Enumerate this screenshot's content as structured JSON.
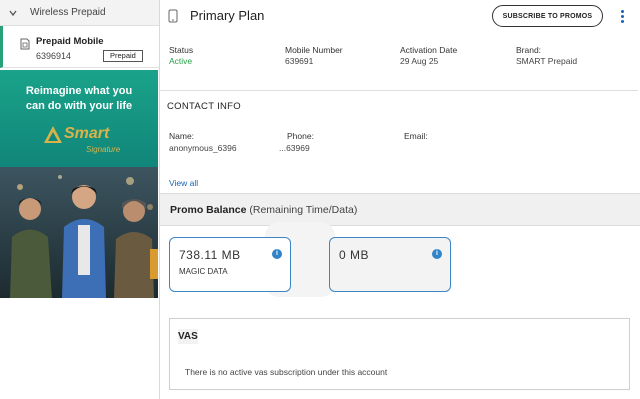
{
  "sidebar": {
    "header_title": "Wireless Prepaid",
    "account": {
      "name": "Prepaid Mobile",
      "number": "6396914",
      "tag": "Prepaid"
    },
    "banner": {
      "headline_line1": "Reimagine what you",
      "headline_line2": "can do with your life",
      "brand": "Smart",
      "brand_sub": "Signature"
    }
  },
  "main": {
    "plan_title": "Primary Plan",
    "subscribe_button": "SUBSCRIBE TO PROMOS",
    "status": {
      "label": "Status",
      "value": "Active"
    },
    "mobile_number": {
      "label": "Mobile Number",
      "value": "639691"
    },
    "activation_date": {
      "label": "Activation Date",
      "value": "29 Aug 25"
    },
    "brand": {
      "label": "Brand:",
      "value": "SMART Prepaid"
    },
    "contact_info": {
      "title": "CONTACT INFO",
      "name_label": "Name:",
      "name_value": "anonymous_6396",
      "phone_label": "Phone:",
      "phone_value": "...63969",
      "email_label": "Email:",
      "view_all": "View all"
    },
    "promo_balance": {
      "title": "Promo Balance",
      "subtitle": "(Remaining Time/Data)",
      "cards": [
        {
          "amount": "738.11 MB",
          "label": "MAGIC DATA"
        },
        {
          "amount": "0 MB",
          "label": ""
        }
      ]
    },
    "vas": {
      "title": "VAS",
      "empty_message": "There is no active vas subscription under this account"
    }
  },
  "colors": {
    "accent_blue": "#1a64b5",
    "active_green": "#2aa04a",
    "card_border": "#3b86c4"
  }
}
